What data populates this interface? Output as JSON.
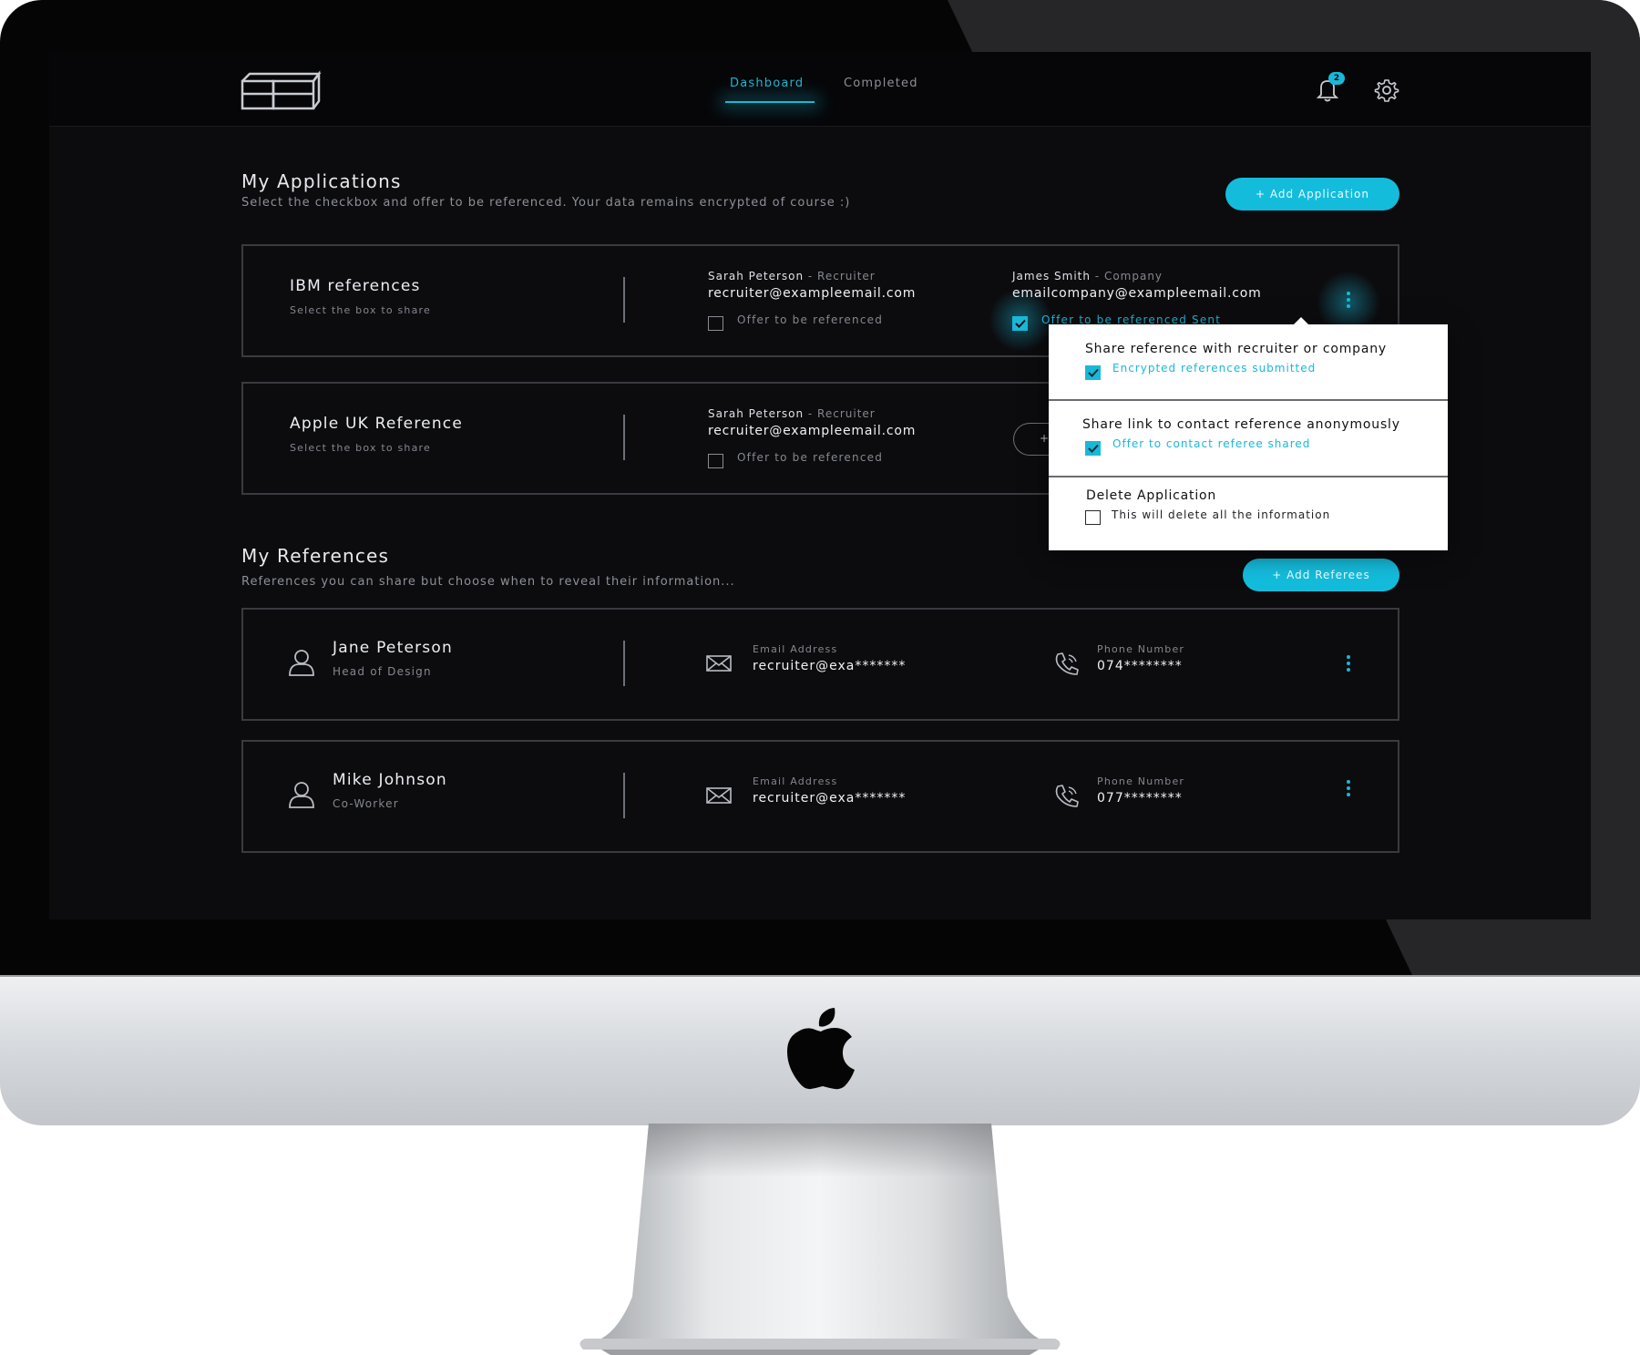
{
  "nav": {
    "tabs": [
      {
        "label": "Dashboard",
        "active": true
      },
      {
        "label": "Completed",
        "active": false
      }
    ],
    "notification_count": "2"
  },
  "applications": {
    "title": "My Applications",
    "subtitle": "Select the checkbox and offer to be referenced. Your data remains encrypted of course :)",
    "add_button": "+ Add Application",
    "items": [
      {
        "title": "IBM references",
        "subtitle": "Select the box to share",
        "recruiter": {
          "name": "Sarah Peterson",
          "role": " - Recruiter",
          "email": "recruiter@exampleemail.com",
          "checkbox_label": "Offer to be referenced",
          "checked": false
        },
        "company": {
          "name": "James Smith",
          "role": "  - Company",
          "email": "emailcompany@exampleemail.com",
          "checkbox_label": "Offer to be referenced Sent",
          "checked": true
        }
      },
      {
        "title": "Apple UK Reference",
        "subtitle": "Select the box to share",
        "recruiter": {
          "name": "Sarah Peterson",
          "role": " - Recruiter",
          "email": "recruiter@exampleemail.com",
          "checkbox_label": "Offer to be referenced",
          "checked": false
        },
        "company_button_glyph": "+"
      }
    ]
  },
  "dropdown": {
    "sections": [
      {
        "title": "Share reference with recruiter or company",
        "label": "Encrypted references submitted",
        "checked": true
      },
      {
        "title": "Share link to contact reference anonymously",
        "label": "Offer to contact referee shared",
        "checked": true
      },
      {
        "title": "Delete Application",
        "label": "This will delete all the information",
        "checked": false
      }
    ]
  },
  "references": {
    "title": "My References",
    "subtitle": "References you can share but choose when to reveal their information...",
    "add_button": "+ Add Referees",
    "items": [
      {
        "name": "Jane Peterson",
        "role": "Head of Design",
        "email_label": "Email Address",
        "email": "recruiter@exa*******",
        "phone_label": "Phone Number",
        "phone": "074********"
      },
      {
        "name": "Mike Johnson",
        "role": "Co-Worker",
        "email_label": "Email Address",
        "email": "recruiter@exa*******",
        "phone_label": "Phone Number",
        "phone": "077********"
      }
    ]
  },
  "colors": {
    "accent": "#19b8d6",
    "screen_bg": "#0c0c0f",
    "card_border": "#3a3b40"
  },
  "icons": [
    "app-logo-icon",
    "bell-icon",
    "gear-icon",
    "kebab-menu-icon",
    "person-icon",
    "envelope-icon",
    "phone-icon",
    "apple-logo-icon",
    "checkmark-icon"
  ]
}
